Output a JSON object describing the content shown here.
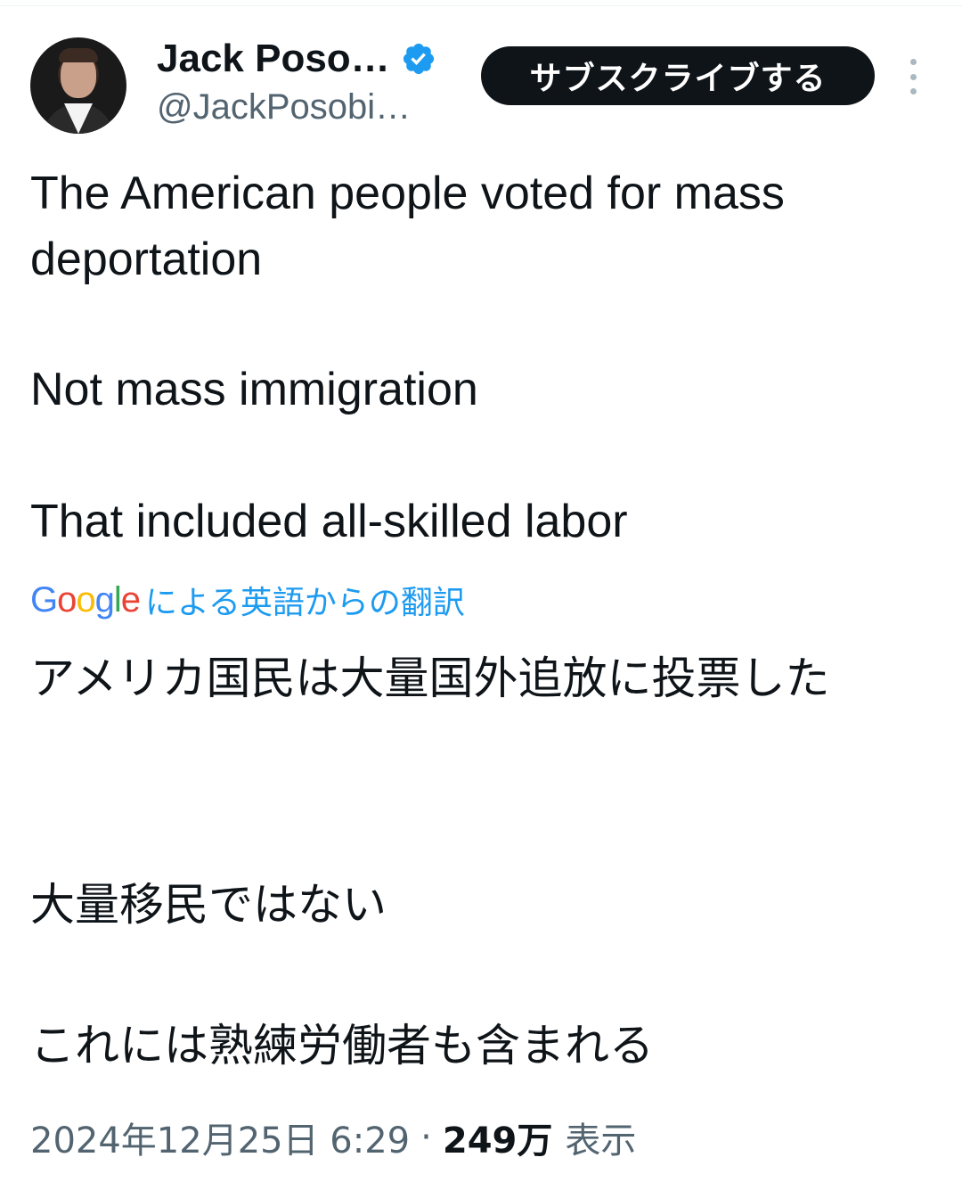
{
  "tweet": {
    "author": {
      "display_name": "Jack Poso…",
      "handle": "@JackPosobi…",
      "verified": true
    },
    "subscribe_label": "サブスクライブする",
    "text_en": [
      "The American people voted for mass deportation",
      "Not mass immigration",
      "That included all-skilled labor"
    ],
    "translation": {
      "google_label": "Google",
      "label": "による英語からの翻訳"
    },
    "text_ja": [
      "アメリカ国民は大量国外追放に投票した",
      "大量移民ではない",
      "これには熟練労働者も含まれる"
    ],
    "timestamp": "2024年12月25日 6:29",
    "separator": "·",
    "views_count": "249万",
    "views_label": "表示"
  },
  "colors": {
    "text": "#0f1419",
    "secondary": "#536471",
    "link": "#1d9bf0",
    "verified": "#1d9bf0",
    "button_bg": "#0f1419"
  },
  "icons": [
    "avatar",
    "verified-badge-icon",
    "more-icon"
  ]
}
